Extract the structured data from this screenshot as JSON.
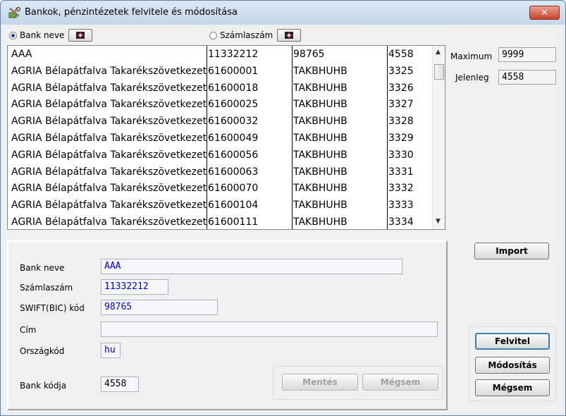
{
  "window": {
    "title": "Bankok, pénzintézetek felvitele és módosítása",
    "close_label": "✕"
  },
  "sort": {
    "bank_name_label": "Bank neve",
    "account_label": "Számlaszám"
  },
  "grid": {
    "rows": [
      [
        "AAA",
        "11332212",
        "98765",
        "4558"
      ],
      [
        "AGRIA Bélapátfalva Takarékszövetkezet",
        "61600001",
        "TAKBHUHB",
        "3325"
      ],
      [
        "AGRIA Bélapátfalva Takarékszövetkezet",
        "61600018",
        "TAKBHUHB",
        "3326"
      ],
      [
        "AGRIA Bélapátfalva Takarékszövetkezet",
        "61600025",
        "TAKBHUHB",
        "3327"
      ],
      [
        "AGRIA Bélapátfalva Takarékszövetkezet",
        "61600032",
        "TAKBHUHB",
        "3328"
      ],
      [
        "AGRIA Bélapátfalva Takarékszövetkezet",
        "61600049",
        "TAKBHUHB",
        "3329"
      ],
      [
        "AGRIA Bélapátfalva Takarékszövetkezet",
        "61600056",
        "TAKBHUHB",
        "3330"
      ],
      [
        "AGRIA Bélapátfalva Takarékszövetkezet",
        "61600063",
        "TAKBHUHB",
        "3331"
      ],
      [
        "AGRIA Bélapátfalva Takarékszövetkezet",
        "61600070",
        "TAKBHUHB",
        "3332"
      ],
      [
        "AGRIA Bélapátfalva Takarékszövetkezet",
        "61600104",
        "TAKBHUHB",
        "3333"
      ],
      [
        "AGRIA Bélapátfalva Takarékszövetkezet",
        "61600111",
        "TAKBHUHB",
        "3334"
      ]
    ]
  },
  "counters": {
    "max_label": "Maximum",
    "max_value": "9999",
    "current_label": "Jelenleg",
    "current_value": "4558"
  },
  "form": {
    "bank_name_label": "Bank neve",
    "bank_name_value": "AAA",
    "account_label": "Számlaszám",
    "account_value": "11332212",
    "swift_label": "SWIFT(BIC) kód",
    "swift_value": "98765",
    "address_label": "Cím",
    "address_value": "",
    "country_label": "Országkód",
    "country_value": "hu",
    "bank_code_label": "Bank kódja",
    "bank_code_value": "4558",
    "save_label": "Mentés",
    "cancel_label": "Mégsem"
  },
  "buttons": {
    "import_label": "Import",
    "add_label": "Felvitel",
    "modify_label": "Módosítás",
    "cancel_label": "Mégsem"
  },
  "colors": {
    "field_text": "#0000cc",
    "accent": "#3c7fb1"
  }
}
